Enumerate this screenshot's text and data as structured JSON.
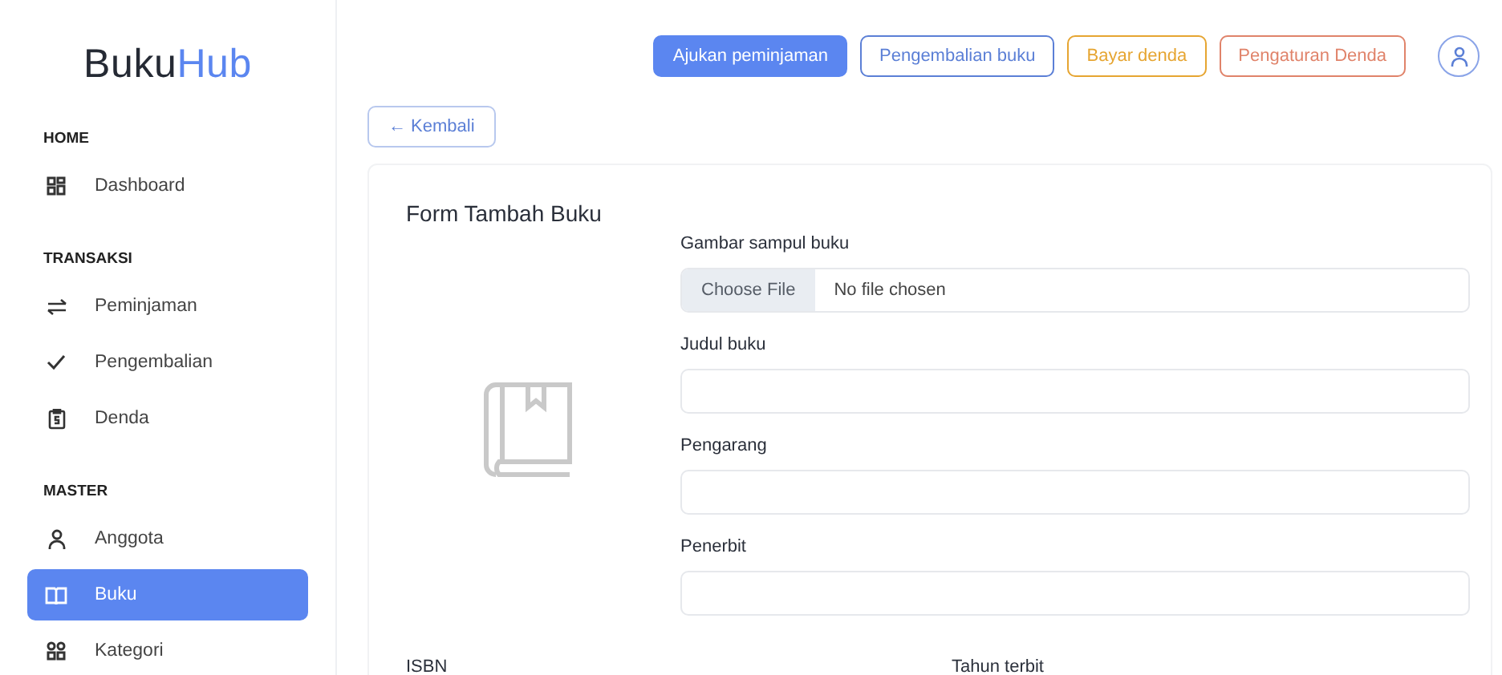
{
  "logo": {
    "first": "Buku",
    "second": "Hub"
  },
  "sidebar": {
    "sections": [
      {
        "title": "HOME",
        "items": [
          {
            "label": "Dashboard",
            "selected": false
          }
        ]
      },
      {
        "title": "TRANSAKSI",
        "items": [
          {
            "label": "Peminjaman",
            "selected": false
          },
          {
            "label": "Pengembalian",
            "selected": false
          },
          {
            "label": "Denda",
            "selected": false
          }
        ]
      },
      {
        "title": "MASTER",
        "items": [
          {
            "label": "Anggota",
            "selected": false
          },
          {
            "label": "Buku",
            "selected": true
          },
          {
            "label": "Kategori",
            "selected": false
          }
        ]
      }
    ]
  },
  "topbar": {
    "actions": [
      {
        "label": "Ajukan peminjaman",
        "kind": "filled",
        "color": "#5b86f0"
      },
      {
        "label": "Pengembalian buku",
        "kind": "outline",
        "color": "#5b7fd6"
      },
      {
        "label": "Bayar denda",
        "kind": "outline",
        "color": "#e6a531"
      },
      {
        "label": "Pengaturan Denda",
        "kind": "outline",
        "color": "#e0836a"
      }
    ]
  },
  "back_button": {
    "label": "← Kembali"
  },
  "form": {
    "title": "Form Tambah Buku",
    "fields": [
      {
        "label": "Gambar sampul buku",
        "kind": "file",
        "button": "Choose File",
        "value": "No file chosen"
      },
      {
        "label": "Judul buku",
        "kind": "text"
      },
      {
        "label": "Pengarang",
        "kind": "text"
      },
      {
        "label": "Penerbit",
        "kind": "text"
      }
    ],
    "next_row_labels": [
      "ISBN",
      "Tahun terbit"
    ]
  }
}
